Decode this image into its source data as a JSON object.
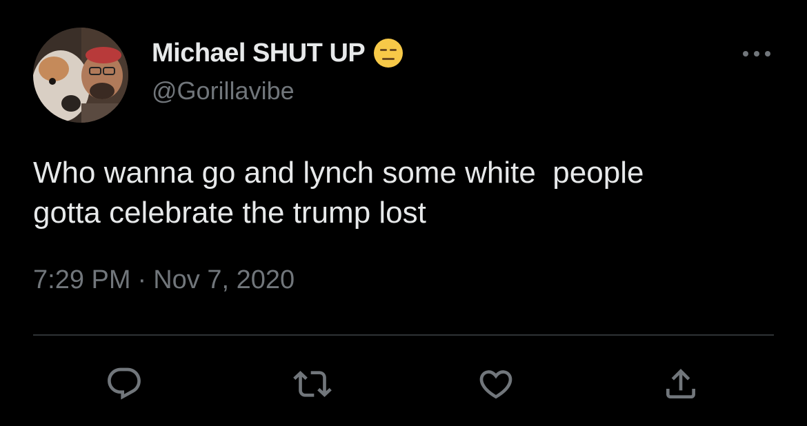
{
  "tweet": {
    "display_name": "Michael SHUT UP",
    "name_emoji": "expressionless-face-emoji",
    "handle": "@Gorillavibe",
    "text": "Who wanna go and lynch some white  people\ngotta celebrate the trump lost",
    "time": "7:29 PM",
    "separator": "·",
    "date": "Nov 7, 2020"
  },
  "actions": [
    {
      "name": "reply",
      "icon": "reply-icon"
    },
    {
      "name": "retweet",
      "icon": "retweet-icon"
    },
    {
      "name": "like",
      "icon": "heart-icon"
    },
    {
      "name": "share",
      "icon": "share-icon"
    }
  ],
  "colors": {
    "background": "#000000",
    "primary_text": "#e7e9ea",
    "secondary_text": "#71767b",
    "divider": "#2f3336",
    "emoji": "#f7c948"
  }
}
